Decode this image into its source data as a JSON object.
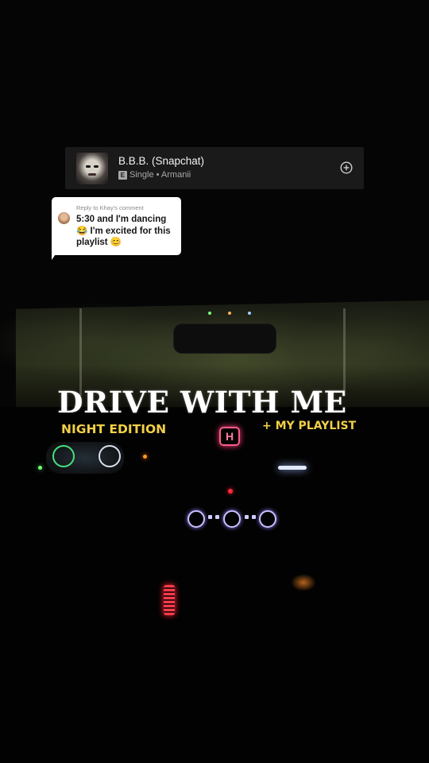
{
  "song_card": {
    "title": "B.B.B. (Snapchat)",
    "explicit": "E",
    "meta": "Single • Armanii",
    "add_icon": "plus-circle-icon"
  },
  "comment": {
    "reply_to": "Reply to Khay's comment",
    "text": "5:30 and I'm dancing 😂 I'm excited for this playlist 😊"
  },
  "overlay": {
    "headline": "DRIVE WITH ME",
    "subtitle_left": "NIGHT EDITION",
    "subtitle_right": "+ MY PLAYLIST",
    "accent_color": "#f2d046"
  },
  "brand_logo": "H"
}
